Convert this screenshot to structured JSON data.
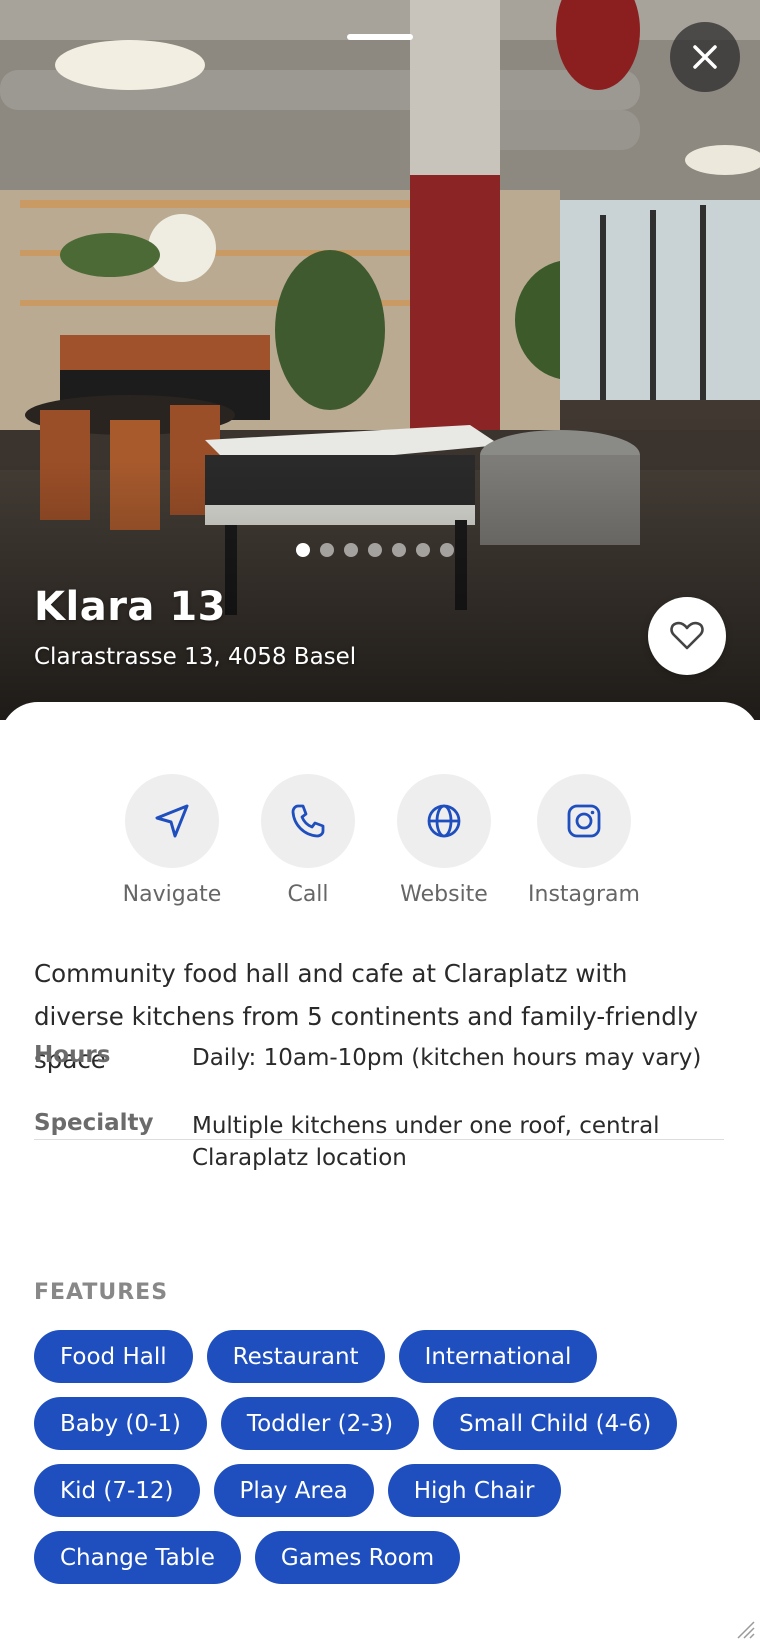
{
  "venue": {
    "name": "Klara 13",
    "address": "Clarastrasse 13, 4058 Basel",
    "description": "Community food hall and cafe at Claraplatz with diverse kitchens from 5 continents and family-friendly space"
  },
  "gallery": {
    "photo_count": 7,
    "active_index": 0
  },
  "actions": [
    {
      "label": "Navigate",
      "icon": "navigate-arrow-icon"
    },
    {
      "label": "Call",
      "icon": "phone-icon"
    },
    {
      "label": "Website",
      "icon": "globe-icon"
    },
    {
      "label": "Instagram",
      "icon": "instagram-icon"
    }
  ],
  "info": [
    {
      "key": "Hours",
      "value": "Daily: 10am-10pm (kitchen hours may vary)"
    },
    {
      "key": "Specialty",
      "value": "Multiple kitchens under one roof, central Claraplatz location"
    }
  ],
  "features": {
    "heading": "FEATURES",
    "rows": [
      [
        "Food Hall",
        "Restaurant",
        "International"
      ],
      [
        "Baby (0-1)",
        "Toddler (2-3)",
        "Small Child (4-6)"
      ],
      [
        "Kid (7-12)",
        "Play Area",
        "High Chair"
      ],
      [
        "Change Table",
        "Games Room"
      ]
    ]
  },
  "colors": {
    "accent": "#1f4fbf",
    "action_circle": "#eeeeee",
    "icon": "#1f4fbf"
  }
}
